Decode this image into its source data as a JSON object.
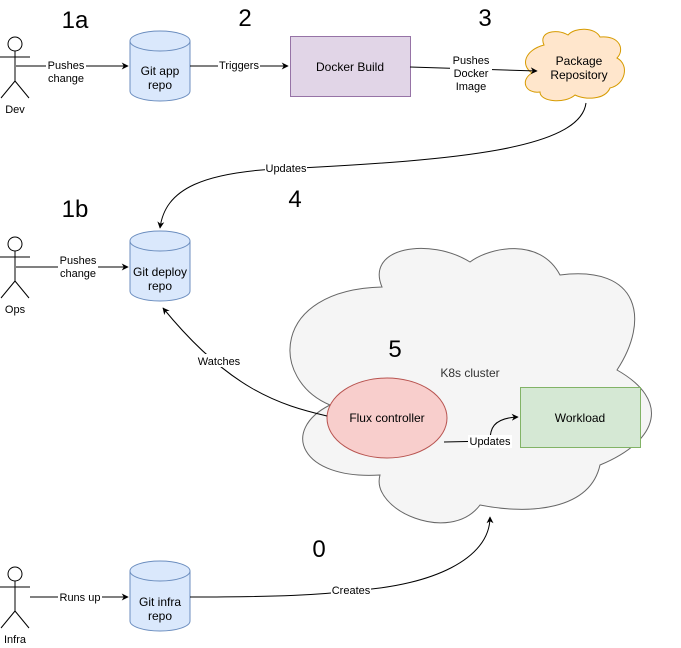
{
  "diagram": {
    "steps": {
      "s1a": "1a",
      "s1b": "1b",
      "s2": "2",
      "s3": "3",
      "s4": "4",
      "s5": "5",
      "s0": "0"
    },
    "actors": {
      "dev": "Dev",
      "ops": "Ops",
      "infra": "Infra"
    },
    "nodes": {
      "git_app_repo": [
        "Git app",
        "repo"
      ],
      "git_deploy_repo": [
        "Git deploy",
        "repo"
      ],
      "git_infra_repo": [
        "Git infra",
        "repo"
      ],
      "docker_build": "Docker Build",
      "package_repository": [
        "Package",
        "Repository"
      ],
      "k8s_cluster": "K8s cluster",
      "flux_controller": "Flux controller",
      "workload": "Workload"
    },
    "edges": {
      "dev_to_app": [
        "Pushes",
        "change"
      ],
      "app_to_build": "Triggers",
      "build_to_pkg": [
        "Pushes",
        "Docker",
        "Image"
      ],
      "pkg_to_deploy": "Updates",
      "ops_to_deploy": [
        "Pushes",
        "change"
      ],
      "flux_to_deploy": "Watches",
      "flux_to_workload": "Updates",
      "infra_to_infra_repo": "Runs up",
      "infra_repo_to_cluster": "Creates"
    },
    "colors": {
      "repo_fill": "#dae8fc",
      "repo_stroke": "#6c8ebf",
      "build_fill": "#e1d5e7",
      "build_stroke": "#9673a6",
      "pkg_fill": "#ffe6cc",
      "pkg_stroke": "#d79b00",
      "cluster_fill": "#f5f5f5",
      "cluster_stroke": "#666666",
      "flux_fill": "#f8cecc",
      "flux_stroke": "#b85450",
      "workload_fill": "#d5e8d4",
      "workload_stroke": "#82b366"
    }
  }
}
